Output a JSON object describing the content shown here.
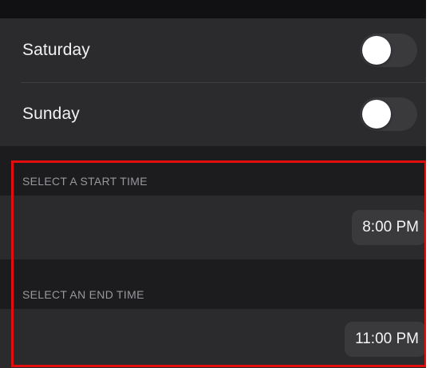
{
  "days": [
    {
      "label": "Saturday",
      "enabled": false
    },
    {
      "label": "Sunday",
      "enabled": false
    }
  ],
  "start_time": {
    "header": "SELECT A START TIME",
    "value": "8:00 PM"
  },
  "end_time": {
    "header": "SELECT AN END TIME",
    "value": "11:00 PM"
  },
  "colors": {
    "background": "#111113",
    "row": "#2b2b2d",
    "section": "#1c1c1e",
    "toggle_off": "#3a3a3d",
    "highlight": "#e10e0e"
  }
}
